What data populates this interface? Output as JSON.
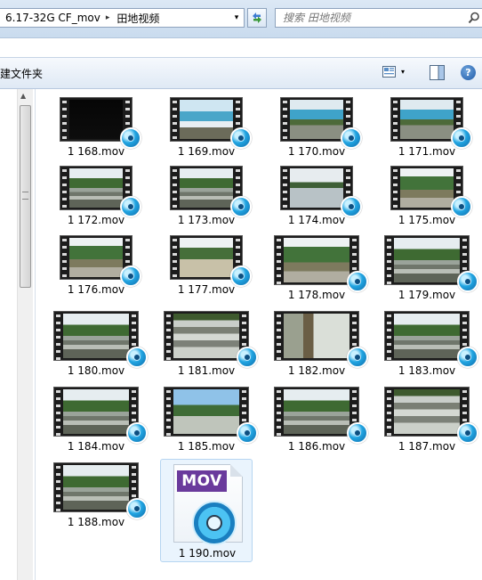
{
  "address": {
    "crumbs": [
      "6.17-32G CF_mov",
      "田地视频"
    ],
    "separator": "▸",
    "dropdown_arrow": "▾",
    "refresh_icon": "refresh-icon"
  },
  "search": {
    "placeholder": "搜索 田地视频",
    "icon": "magnifier-icon"
  },
  "toolbar": {
    "new_folder_label": "建文件夹",
    "view_icon": "view-options-icon",
    "view_dropdown": "▾",
    "preview_icon": "preview-pane-icon",
    "help_label": "?"
  },
  "files": [
    {
      "name": "1 168.mov",
      "scene": "dark"
    },
    {
      "name": "1 169.mov",
      "scene": "sign"
    },
    {
      "name": "1 170.mov",
      "scene": "signfield"
    },
    {
      "name": "1 171.mov",
      "scene": "signfield"
    },
    {
      "name": "1 172.mov",
      "scene": "field"
    },
    {
      "name": "1 173.mov",
      "scene": "field"
    },
    {
      "name": "1 174.mov",
      "scene": "water"
    },
    {
      "name": "1 175.mov",
      "scene": "hills"
    },
    {
      "name": "1 176.mov",
      "scene": "hills"
    },
    {
      "name": "1 177.mov",
      "scene": "road"
    },
    {
      "name": "1 178.mov",
      "scene": "hills"
    },
    {
      "name": "1 179.mov",
      "scene": "field"
    },
    {
      "name": "1 180.mov",
      "scene": "field"
    },
    {
      "name": "1 181.mov",
      "scene": "plastic"
    },
    {
      "name": "1 182.mov",
      "scene": "ditch"
    },
    {
      "name": "1 183.mov",
      "scene": "field"
    },
    {
      "name": "1 184.mov",
      "scene": "field"
    },
    {
      "name": "1 185.mov",
      "scene": "sky"
    },
    {
      "name": "1 186.mov",
      "scene": "field"
    },
    {
      "name": "1 187.mov",
      "scene": "plastic"
    },
    {
      "name": "1 188.mov",
      "scene": "field"
    },
    {
      "name": "1 190.mov",
      "scene": "movicon"
    }
  ],
  "mov_tag": "MOV",
  "colors": {
    "mov_tag": "#6a3a9c",
    "selection": "#eaf4fd",
    "badge": "#22a5e2"
  }
}
